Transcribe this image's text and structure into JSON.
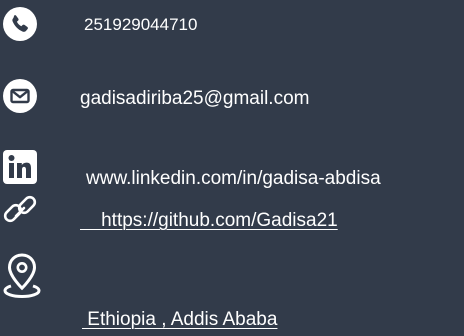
{
  "contacts": [
    {
      "type": "phone",
      "icon": "phone-icon",
      "text": "251929044710"
    },
    {
      "type": "email",
      "icon": "envelope-icon",
      "text": "gadisadiriba25@gmail.com"
    },
    {
      "type": "linkedin",
      "icon": "linkedin-icon",
      "text": "www.linkedin.com/in/gadisa-abdisa"
    },
    {
      "type": "github",
      "icon": "chain-link-icon",
      "text": "    https://github.com/Gadisa21"
    },
    {
      "type": "location",
      "icon": "location-pin-icon",
      "text": " Ethiopia , Addis Ababa"
    }
  ],
  "colors": {
    "background": "#323b4a",
    "foreground": "#ffffff"
  }
}
